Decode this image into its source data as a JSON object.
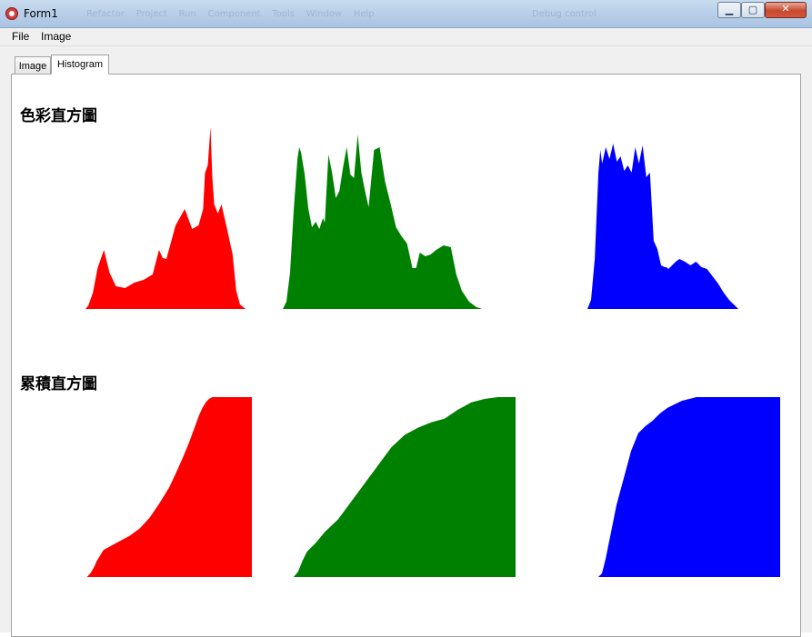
{
  "window": {
    "title": "Form1"
  },
  "ide_background": {
    "menu": [
      "Refactor",
      "Project",
      "Run",
      "Component",
      "Tools",
      "Window",
      "Help"
    ],
    "config": "Debug control"
  },
  "menu": [
    "File",
    "Image"
  ],
  "tabs": [
    {
      "label": "Image",
      "active": false
    },
    {
      "label": "Histogram",
      "active": true
    }
  ],
  "sections": {
    "color_histogram_title": "色彩直方圖",
    "cumulative_histogram_title": "累積直方圖"
  },
  "chart_data": [
    {
      "type": "area",
      "title": "色彩直方圖",
      "x_domain": [
        0,
        255
      ],
      "series": [
        {
          "channel": "red",
          "color": "#ff0000",
          "x": [
            0,
            12,
            15,
            20,
            25,
            32,
            38,
            45,
            55,
            65,
            75,
            85,
            92,
            96,
            100,
            110,
            120,
            128,
            135,
            140,
            142,
            145,
            148,
            150,
            152,
            156,
            160,
            166,
            172,
            176,
            180,
            186,
            190,
            194
          ],
          "y": [
            0,
            0,
            4,
            18,
            45,
            65,
            40,
            25,
            23,
            29,
            32,
            38,
            65,
            56,
            55,
            92,
            110,
            88,
            92,
            110,
            150,
            158,
            200,
            145,
            115,
            105,
            115,
            88,
            60,
            20,
            5,
            0,
            0,
            0
          ]
        },
        {
          "channel": "green",
          "color": "#008000",
          "x": [
            0,
            4,
            8,
            12,
            16,
            18,
            20,
            24,
            28,
            32,
            36,
            40,
            44,
            46,
            50,
            54,
            58,
            62,
            66,
            70,
            74,
            78,
            82,
            86,
            90,
            94,
            100,
            106,
            112,
            118,
            124,
            130,
            136,
            142,
            146,
            150,
            156,
            162,
            168,
            176,
            184,
            190,
            196,
            204,
            212,
            218,
            224,
            230
          ],
          "y": [
            0,
            8,
            40,
            110,
            165,
            178,
            172,
            148,
            110,
            90,
            96,
            88,
            100,
            95,
            170,
            150,
            122,
            130,
            156,
            178,
            148,
            144,
            192,
            150,
            130,
            112,
            175,
            178,
            140,
            116,
            90,
            80,
            72,
            45,
            45,
            62,
            58,
            60,
            65,
            70,
            68,
            38,
            20,
            8,
            2,
            0,
            0,
            0
          ]
        },
        {
          "channel": "blue",
          "color": "#0000ff",
          "x": [
            0,
            4,
            8,
            12,
            14,
            16,
            20,
            24,
            28,
            32,
            36,
            40,
            44,
            48,
            52,
            56,
            60,
            64,
            68,
            72,
            76,
            80,
            84,
            86,
            88,
            92,
            96,
            100,
            106,
            112,
            118,
            124,
            130,
            136,
            142,
            148,
            154,
            160,
            164,
            168
          ],
          "y": [
            0,
            10,
            55,
            150,
            175,
            160,
            178,
            165,
            182,
            162,
            168,
            152,
            158,
            150,
            178,
            160,
            180,
            145,
            150,
            75,
            66,
            48,
            46,
            46,
            44,
            48,
            52,
            55,
            52,
            48,
            52,
            46,
            44,
            36,
            28,
            18,
            10,
            4,
            0,
            0
          ]
        }
      ]
    },
    {
      "type": "area",
      "title": "累積直方圖",
      "x_domain": [
        0,
        255
      ],
      "y_domain": [
        0,
        1
      ],
      "series": [
        {
          "channel": "red",
          "color": "#ff0000",
          "x": [
            0,
            5,
            10,
            15,
            20,
            30,
            40,
            55,
            70,
            85,
            100,
            115,
            130,
            140,
            150,
            160,
            168,
            175,
            180,
            185,
            190,
            195,
            200,
            210,
            220,
            255
          ],
          "y": [
            0,
            0,
            0.02,
            0.05,
            0.09,
            0.15,
            0.17,
            0.2,
            0.23,
            0.27,
            0.33,
            0.41,
            0.5,
            0.58,
            0.66,
            0.75,
            0.83,
            0.9,
            0.94,
            0.97,
            0.99,
            1,
            1,
            1,
            1,
            1
          ]
        },
        {
          "channel": "green",
          "color": "#008000",
          "x": [
            0,
            5,
            10,
            15,
            20,
            30,
            40,
            55,
            70,
            85,
            100,
            115,
            130,
            145,
            160,
            175,
            190,
            205,
            220,
            235,
            245,
            255
          ],
          "y": [
            0,
            0,
            0.03,
            0.09,
            0.14,
            0.19,
            0.25,
            0.32,
            0.42,
            0.52,
            0.62,
            0.72,
            0.79,
            0.83,
            0.86,
            0.88,
            0.93,
            0.97,
            0.99,
            1,
            1,
            1
          ]
        },
        {
          "channel": "blue",
          "color": "#0000ff",
          "x": [
            0,
            5,
            10,
            15,
            20,
            25,
            30,
            40,
            50,
            60,
            70,
            80,
            90,
            100,
            110,
            120,
            130,
            140,
            150,
            160,
            170,
            180,
            190,
            200,
            210,
            220,
            230,
            240,
            255
          ],
          "y": [
            0,
            0,
            0.02,
            0.1,
            0.2,
            0.3,
            0.4,
            0.55,
            0.7,
            0.8,
            0.84,
            0.87,
            0.91,
            0.94,
            0.96,
            0.98,
            0.99,
            1,
            1,
            1,
            1,
            1,
            1,
            1,
            1,
            1,
            1,
            1,
            1
          ]
        }
      ]
    }
  ]
}
